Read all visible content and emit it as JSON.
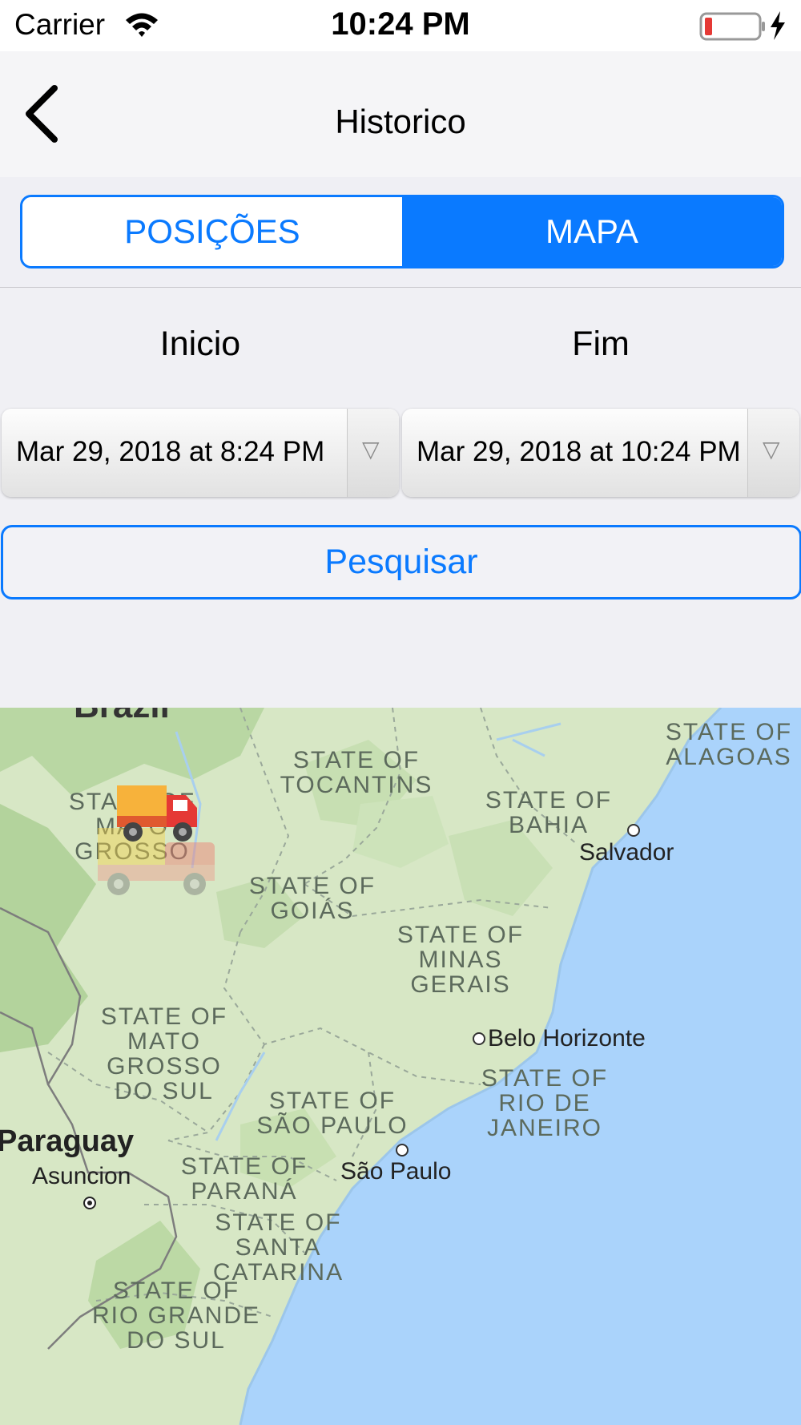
{
  "status_bar": {
    "carrier": "Carrier",
    "time": "10:24 PM"
  },
  "nav": {
    "title": "Historico"
  },
  "segments": {
    "positions": "POSIÇÕES",
    "map": "MAPA",
    "selected": "MAPA"
  },
  "filters": {
    "start_label": "Inicio",
    "end_label": "Fim",
    "start_value": "Mar 29, 2018 at 8:24 PM",
    "end_value": "Mar 29, 2018 at 10:24 PM"
  },
  "search_button": "Pesquisar",
  "map": {
    "country_top": "Brazil",
    "regions": {
      "tocantins": "STATE OF\nTOCANTINS",
      "alagoas": "STATE OF\nALAGOAS",
      "bahia": "STATE OF\nBAHIA",
      "mato_grosso": "STATE OF\nMATO\nGROSSO",
      "goias": "STATE OF\nGOIÁS",
      "minas": "STATE OF\nMINAS\nGERAIS",
      "ms": "STATE OF\nMATO\nGROSSO\nDO SUL",
      "sp": "STATE OF\nSÃO PAULO",
      "rj": "STATE OF\nRIO DE\nJANEIRO",
      "parana": "STATE OF\nPARANÁ",
      "sc": "STATE OF\nSANTA\nCATARINA",
      "rs": "STATE OF\nRIO GRANDE\nDO SUL"
    },
    "cities": {
      "salvador": "Salvador",
      "belo_horizonte": "Belo Horizonte",
      "sao_paulo": "São Paulo",
      "asuncion": "Asuncion"
    },
    "country_paraguay": "Paraguay",
    "colors": {
      "land": "#d8e8c8",
      "forest": "#b8d8a4",
      "water": "#aad3fb"
    }
  }
}
